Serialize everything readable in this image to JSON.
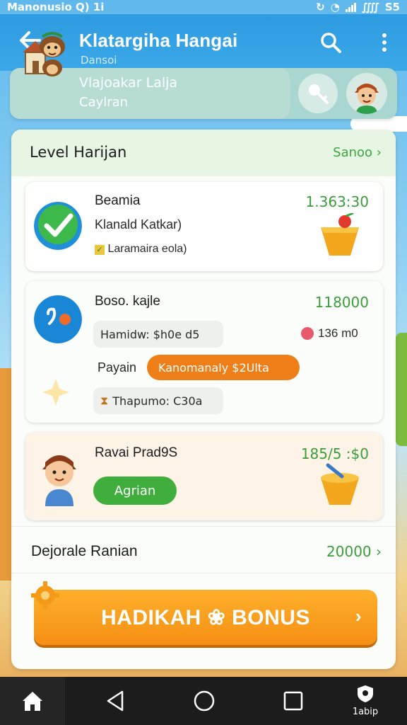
{
  "status_bar": {
    "left_text": "Manonusio Q) 1i",
    "right_text": "S5"
  },
  "app_bar": {
    "title": "Klatargiha Hangai",
    "subtitle": "Dansoi",
    "icons": [
      "back-arrow-icon",
      "search-icon",
      "more-vert-icon"
    ]
  },
  "banner": {
    "line1": "Vlajoakar Lalja",
    "line2": "Caylran",
    "icons": [
      "key-icon",
      "avatar"
    ]
  },
  "section": {
    "title": "Level Harijan",
    "see_all": "Sanoo"
  },
  "card1": {
    "title": "Beamia",
    "amount": "1.363:30",
    "subtitle": "Klanald Katkar)",
    "note": "Laramaira eola)"
  },
  "card2": {
    "title": "Boso. kajle",
    "amount": "118000",
    "chip_left": "Hamidw: $h0e d5",
    "chip_right": "136 m0",
    "label": "Payain",
    "pill": "Kanomanaly $2Ulta",
    "note": "Thapumo: C30a"
  },
  "card3": {
    "title": "Ravai Prad9S",
    "amount": "185/5 :$0",
    "button": "Agrian"
  },
  "footer_row": {
    "label": "Dejorale Ranian",
    "amount": "20000"
  },
  "bonus_button": {
    "label": "HADIKAH ❀ BONUS"
  },
  "nav_bar": {
    "right_label": "1abip",
    "icons": [
      "home-icon",
      "back-triangle-icon",
      "home-circle-icon",
      "recents-square-icon",
      "shield-icon"
    ]
  },
  "colors": {
    "primary": "#2e9be0",
    "green": "#3aa63d",
    "orange": "#f58f14"
  }
}
